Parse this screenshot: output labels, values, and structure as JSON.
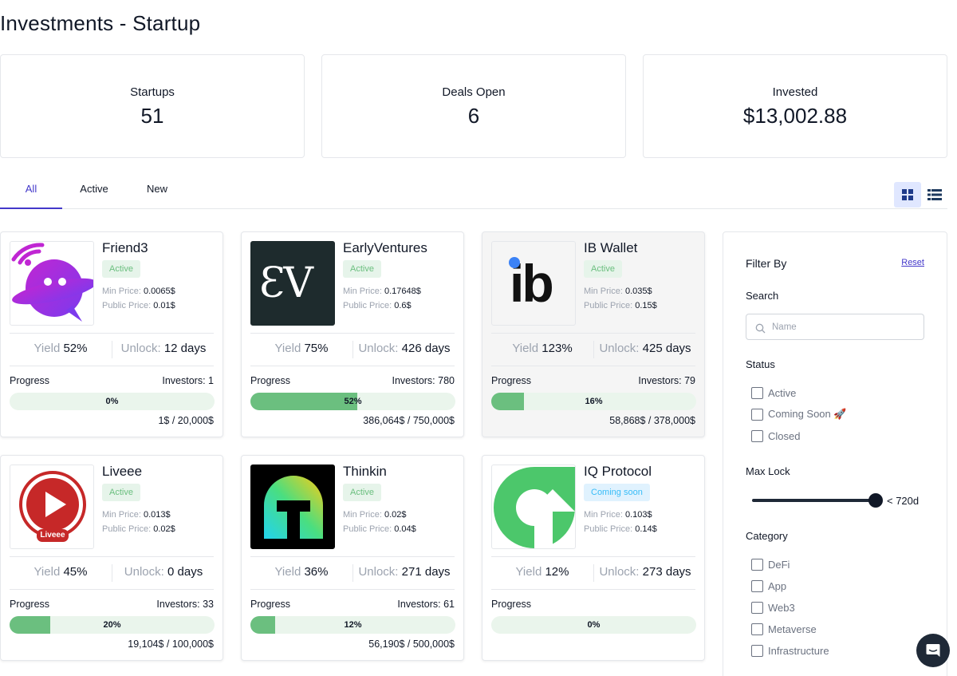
{
  "page": {
    "title": "Investments - Startup"
  },
  "stats": [
    {
      "label": "Startups",
      "value": "51"
    },
    {
      "label": "Deals Open",
      "value": "6"
    },
    {
      "label": "Invested",
      "value": "$13,002.88"
    }
  ],
  "tabs": [
    {
      "label": "All",
      "active": true
    },
    {
      "label": "Active",
      "active": false
    },
    {
      "label": "New",
      "active": false
    }
  ],
  "view": {
    "grid_icon": "grid-icon",
    "list_icon": "list-icon",
    "selected": "grid"
  },
  "labels": {
    "min_price": "Min Price:",
    "public_price": "Public Price:",
    "yield": "Yield",
    "unlock": "Unlock:",
    "progress": "Progress",
    "investors": "Investors:"
  },
  "startups": [
    {
      "name": "Friend3",
      "status": "Active",
      "min_price": "0.0065$",
      "public_price": "0.01$",
      "yield": "52%",
      "unlock": "12 days",
      "investors": "1",
      "progress": 0,
      "progress_label": "0%",
      "raised": "1$ / 20,000$",
      "logo": "friend3-logo"
    },
    {
      "name": "EarlyVentures",
      "status": "Active",
      "min_price": "0.17648$",
      "public_price": "0.6$",
      "yield": "75%",
      "unlock": "426 days",
      "investors": "780",
      "progress": 52,
      "progress_label": "52%",
      "raised": "386,064$ / 750,000$",
      "logo": "earlyventures-logo",
      "logo_text": "ƐV"
    },
    {
      "name": "IB Wallet",
      "status": "Active",
      "min_price": "0.035$",
      "public_price": "0.15$",
      "yield": "123%",
      "unlock": "425 days",
      "investors": "79",
      "progress": 16,
      "progress_label": "16%",
      "raised": "58,868$ / 378,000$",
      "logo": "ib-wallet-logo",
      "logo_text": "ib"
    },
    {
      "name": "Liveee",
      "status": "Active",
      "min_price": "0.013$",
      "public_price": "0.02$",
      "yield": "45%",
      "unlock": "0 days",
      "investors": "33",
      "progress": 20,
      "progress_label": "20%",
      "raised": "19,104$ / 100,000$",
      "logo": "liveee-logo",
      "logo_text": "Liveee"
    },
    {
      "name": "Thinkin",
      "status": "Active",
      "min_price": "0.02$",
      "public_price": "0.04$",
      "yield": "36%",
      "unlock": "271 days",
      "investors": "61",
      "progress": 12,
      "progress_label": "12%",
      "raised": "56,190$ / 500,000$",
      "logo": "thinkin-logo"
    },
    {
      "name": "IQ Protocol",
      "status": "Coming soon",
      "min_price": "0.103$",
      "public_price": "0.14$",
      "yield": "12%",
      "unlock": "273 days",
      "investors": "",
      "progress": 0,
      "progress_label": "0%",
      "raised": "",
      "logo": "iq-protocol-logo"
    }
  ],
  "filter": {
    "title": "Filter By",
    "reset": "Reset",
    "search_label": "Search",
    "search_placeholder": "Name",
    "search_value": "",
    "status_label": "Status",
    "status_options": [
      "Active",
      "Coming Soon 🚀",
      "Closed"
    ],
    "max_lock_label": "Max Lock",
    "max_lock_value": "< 720d",
    "max_lock_fraction": 1.0,
    "category_label": "Category",
    "category_options": [
      "DeFi",
      "App",
      "Web3",
      "Metaverse",
      "Infrastructure"
    ]
  },
  "colors": {
    "accent": "#4338ca",
    "progress_fill": "#6bbf7f",
    "progress_track": "#eaf5ec",
    "active_badge_bg": "#e6f4ea",
    "soon_badge_bg": "#e0f2fe"
  },
  "chat": {
    "icon": "chat-icon"
  }
}
